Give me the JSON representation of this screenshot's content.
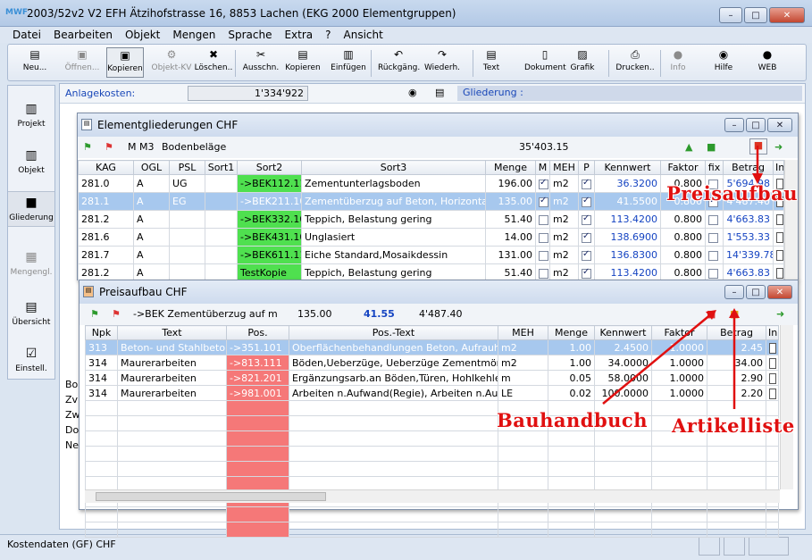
{
  "app": {
    "title": "2003/52v2 V2 EFH Ätzihofstrasse 16, 8853 Lachen (EKG 2000 Elementgruppen)",
    "app_icon": "MWF",
    "caption": {
      "min": "–",
      "max": "□",
      "close": "✕"
    }
  },
  "menu": [
    "Datei",
    "Bearbeiten",
    "Objekt",
    "Mengen",
    "Sprache",
    "Extra",
    "?",
    "Ansicht"
  ],
  "toolbar": [
    {
      "label": "Neu...",
      "icon": "new-file-icon",
      "glyph": "▤",
      "state": "normal"
    },
    {
      "label": "Öffnen...",
      "icon": "open-icon",
      "glyph": "▣",
      "state": "disabled"
    },
    {
      "label": "Kopieren",
      "icon": "copy-icon",
      "glyph": "▣",
      "state": "selected"
    },
    {
      "label": "Objekt-KV",
      "icon": "gear-icon",
      "glyph": "⚙",
      "state": "disabled"
    },
    {
      "label": "Löschen..",
      "icon": "delete-icon",
      "glyph": "✖",
      "state": "normal"
    },
    {
      "label": "Ausschn.",
      "icon": "cut-icon",
      "glyph": "✂",
      "state": "normal"
    },
    {
      "label": "Kopieren",
      "icon": "copy-icon",
      "glyph": "▤",
      "state": "normal"
    },
    {
      "label": "Einfügen",
      "icon": "paste-icon",
      "glyph": "▥",
      "state": "normal"
    },
    {
      "label": "Rückgäng.",
      "icon": "undo-icon",
      "glyph": "↶",
      "state": "normal"
    },
    {
      "label": "Wiederh.",
      "icon": "redo-icon",
      "glyph": "↷",
      "state": "normal"
    },
    {
      "label": "Text",
      "icon": "text-document-icon",
      "glyph": "▤",
      "state": "normal"
    },
    {
      "label": "Dokument",
      "icon": "document-icon",
      "glyph": "▯",
      "state": "normal"
    },
    {
      "label": "Grafik",
      "icon": "image-icon",
      "glyph": "▨",
      "state": "normal"
    },
    {
      "label": "Drucken..",
      "icon": "printer-icon",
      "glyph": "⎙",
      "state": "normal"
    },
    {
      "label": "Info",
      "icon": "info-icon",
      "glyph": "●",
      "state": "disabled"
    },
    {
      "label": "Hilfe",
      "icon": "help-icon",
      "glyph": "◉",
      "state": "normal"
    },
    {
      "label": "WEB",
      "icon": "globe-icon",
      "glyph": "●",
      "state": "normal"
    }
  ],
  "leftnav": [
    {
      "label": "Projekt",
      "icon": "folder-icon",
      "glyph": "▥",
      "state": "normal"
    },
    {
      "label": "Objekt",
      "icon": "object-folder-icon",
      "glyph": "▥",
      "state": "normal"
    },
    {
      "label": "Gliederung",
      "icon": "structure-icon",
      "glyph": "■",
      "state": "active"
    },
    {
      "label": "Mengengl.",
      "icon": "quantity-icon",
      "glyph": "▦",
      "state": "disabled"
    },
    {
      "label": "Übersicht",
      "icon": "overview-icon",
      "glyph": "▤",
      "state": "normal"
    },
    {
      "label": "Einstell.",
      "icon": "settings-icon",
      "glyph": "☑",
      "state": "normal"
    }
  ],
  "anlage": {
    "label": "Anlagekosten:",
    "value": "1'334'922",
    "gliederung_label": "Gliederung :"
  },
  "background_rows": [
    "Bo",
    "Zv",
    "Zw",
    "Do",
    "Ne"
  ],
  "status": {
    "text": "Kostendaten (GF) CHF"
  },
  "elementgliederung": {
    "title": "Elementgliederungen CHF",
    "code": "M M3",
    "name": "Bodenbeläge",
    "total": "35'403.15",
    "columns": [
      "KAG",
      "OGL",
      "PSL",
      "Sort1",
      "Sort2",
      "Sort3",
      "Menge",
      "M",
      "MEH",
      "P",
      "Kennwert",
      "Faktor",
      "fix",
      "Betrag",
      "In"
    ],
    "rows": [
      {
        "kag": "281.0",
        "ogl": "A",
        "psl": "UG",
        "sort1": "",
        "sort2": "->BEK112.111",
        "sort3": "Zementunterlagsboden",
        "menge": "196.00",
        "m": true,
        "meh": "m2",
        "p": true,
        "kennwert": "36.3200",
        "faktor": "0.800",
        "fix": false,
        "betrag": "5'694.98",
        "hl": false
      },
      {
        "kag": "281.1",
        "ogl": "A",
        "psl": "EG",
        "sort1": "",
        "sort2": "->BEK211.101",
        "sort3": "Zementüberzug auf Beton, Horizontal",
        "menge": "135.00",
        "m": true,
        "meh": "m2",
        "p": true,
        "kennwert": "41.5500",
        "faktor": "0.800",
        "fix": true,
        "betrag": "4'487.40",
        "hl": true
      },
      {
        "kag": "281.2",
        "ogl": "A",
        "psl": "",
        "sort1": "",
        "sort2": "->BEK332.101",
        "sort3": "Teppich, Belastung gering",
        "menge": "51.40",
        "m": false,
        "meh": "m2",
        "p": true,
        "kennwert": "113.4200",
        "faktor": "0.800",
        "fix": false,
        "betrag": "4'663.83",
        "hl": false
      },
      {
        "kag": "281.6",
        "ogl": "A",
        "psl": "",
        "sort1": "",
        "sort2": "->BEK431.101",
        "sort3": "Unglasiert",
        "menge": "14.00",
        "m": false,
        "meh": "m2",
        "p": true,
        "kennwert": "138.6900",
        "faktor": "0.800",
        "fix": false,
        "betrag": "1'553.33",
        "hl": false
      },
      {
        "kag": "281.7",
        "ogl": "A",
        "psl": "",
        "sort1": "",
        "sort2": "->BEK611.111",
        "sort3": "Eiche Standard,Mosaikdessin",
        "menge": "131.00",
        "m": false,
        "meh": "m2",
        "p": true,
        "kennwert": "136.8300",
        "faktor": "0.800",
        "fix": false,
        "betrag": "14'339.78",
        "hl": false
      },
      {
        "kag": "281.2",
        "ogl": "A",
        "psl": "",
        "sort1": "",
        "sort2": "TestKopie",
        "sort3": "Teppich, Belastung gering",
        "menge": "51.40",
        "m": false,
        "meh": "m2",
        "p": true,
        "kennwert": "113.4200",
        "faktor": "0.800",
        "fix": false,
        "betrag": "4'663.83",
        "hl": false
      }
    ]
  },
  "preisaufbau": {
    "title": "Preisaufbau CHF",
    "ref": "->BEK Zementüberzug auf m",
    "menge": "135.00",
    "kennwert": "41.55",
    "betrag": "4'487.40",
    "columns": [
      "Npk",
      "Text",
      "Pos.",
      "Pos.-Text",
      "MEH",
      "Menge",
      "Kennwert",
      "Faktor",
      "Betrag",
      "In"
    ],
    "rows": [
      {
        "npk": "313",
        "text": "Beton- und Stahlbetonar",
        "pos": "->351.101",
        "postext": "Oberflächenbehandlungen Beton, Aufrauhen B",
        "meh": "m2",
        "menge": "1.00",
        "kennwert": "2.4500",
        "faktor": "1.0000",
        "betrag": "2.45",
        "hl": true
      },
      {
        "npk": "314",
        "text": "Maurerarbeiten",
        "pos": "->813.111",
        "postext": "Böden,Ueberzüge, Ueberzüge Zementmörtel, U",
        "meh": "m2",
        "menge": "1.00",
        "kennwert": "34.0000",
        "faktor": "1.0000",
        "betrag": "34.00",
        "hl": false
      },
      {
        "npk": "314",
        "text": "Maurerarbeiten",
        "pos": "->821.201",
        "postext": "Ergänzungsarb.an Böden,Türen, Hohlkehlen,Tü",
        "meh": "m",
        "menge": "0.05",
        "kennwert": "58.0000",
        "faktor": "1.0000",
        "betrag": "2.90",
        "hl": false
      },
      {
        "npk": "314",
        "text": "Maurerarbeiten",
        "pos": "->981.001",
        "postext": "Arbeiten n.Aufwand(Regie), Arbeiten n.Aufwa",
        "meh": "LE",
        "menge": "0.02",
        "kennwert": "100.0000",
        "faktor": "1.0000",
        "betrag": "2.20",
        "hl": false
      }
    ],
    "empty_rows": 9
  },
  "annotations": {
    "preisaufbau": "Preisaufbau",
    "bauhandbuch": "Bauhandbuch",
    "artikelliste": "Artikelliste"
  },
  "colors": {
    "accent_red": "#e01010",
    "pos_green": "#4fe04f",
    "pos_red": "#f57878",
    "link_blue": "#1544c2"
  }
}
